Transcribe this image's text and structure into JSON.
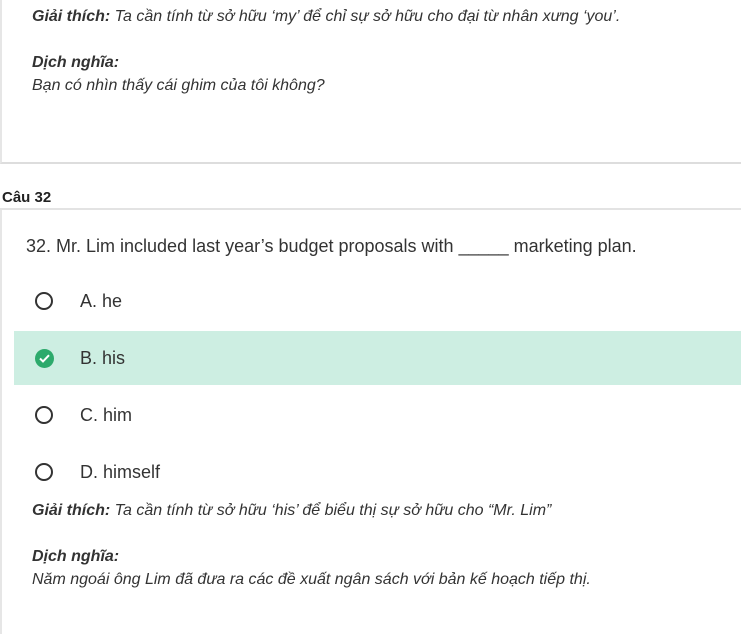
{
  "prev_question": {
    "explain_label": "Giải thích:",
    "explain_text": " Ta cần tính từ sở hữu ‘my’ để chỉ sự sở hữu cho đại từ nhân xưng ‘you’.",
    "translate_label": "Dịch nghĩa:",
    "translate_text": "Bạn có nhìn thấy cái ghim của tôi không?"
  },
  "question": {
    "label": "Câu 32",
    "text": "32. Mr. Lim included last year’s budget proposals with _____ marketing plan.",
    "options": [
      {
        "label": "A. he",
        "selected": false
      },
      {
        "label": "B. his",
        "selected": true
      },
      {
        "label": "C. him",
        "selected": false
      },
      {
        "label": "D. himself",
        "selected": false
      }
    ],
    "explain_label": "Giải thích:",
    "explain_text": " Ta cần tính từ sở hữu ‘his’ để biểu thị sự sở hữu cho “Mr. Lim”",
    "translate_label": "Dịch nghĩa:",
    "translate_text": "Năm ngoái ông Lim đã đưa ra các đề xuất ngân sách với bản kế hoạch tiếp thị."
  },
  "colors": {
    "selected_bg": "#cdeee2",
    "check_green": "#2daa6c"
  }
}
